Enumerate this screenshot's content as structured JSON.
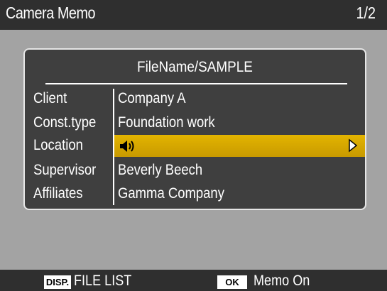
{
  "header": {
    "title": "Camera Memo",
    "page_indicator": "1/2"
  },
  "memo": {
    "filename": "FileName/SAMPLE",
    "rows": [
      {
        "label": "Client",
        "value": "Company A"
      },
      {
        "label": "Const.type",
        "value": "Foundation work"
      },
      {
        "label": "Location",
        "value": "",
        "icon": "speaker-icon",
        "selected": true
      },
      {
        "label": "Supervisor",
        "value": "Beverly Beech"
      },
      {
        "label": "Affiliates",
        "value": "Gamma Company"
      }
    ]
  },
  "footer": {
    "disp_badge": "DISP.",
    "disp_text": "FILE LIST",
    "ok_badge": "OK",
    "ok_text": "Memo On"
  },
  "colors": {
    "background": "#a3a3a3",
    "bars": "#2f2f2f",
    "panel": "#3f3f3f",
    "highlight": "#d9aa00",
    "text": "#ffffff"
  }
}
